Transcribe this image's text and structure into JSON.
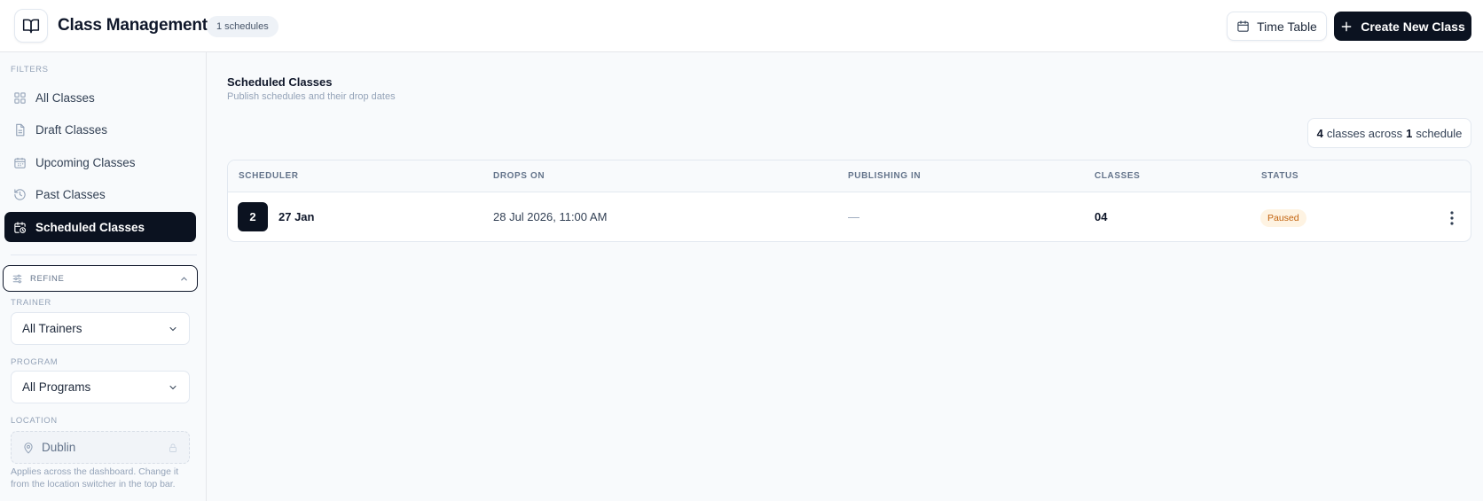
{
  "header": {
    "title": "Class Management",
    "schedule_count": "1 schedules",
    "timetable_label": "Time Table",
    "create_label": "Create New Class"
  },
  "sidebar": {
    "filters_label": "FILTERS",
    "items": [
      {
        "label": "All Classes",
        "icon": "grid-icon"
      },
      {
        "label": "Draft Classes",
        "icon": "document-icon"
      },
      {
        "label": "Upcoming Classes",
        "icon": "calendar-icon"
      },
      {
        "label": "Past Classes",
        "icon": "history-icon"
      },
      {
        "label": "Scheduled Classes",
        "icon": "calendar-clock-icon",
        "active": true
      }
    ],
    "refine_label": "REFINE",
    "trainer": {
      "label": "TRAINER",
      "value": "All Trainers"
    },
    "program": {
      "label": "PROGRAM",
      "value": "All Programs"
    },
    "location": {
      "label": "LOCATION",
      "value": "Dublin",
      "help": "Applies across the dashboard. Change it from the location switcher in the top bar."
    }
  },
  "main": {
    "title": "Scheduled Classes",
    "subtitle": "Publish schedules and their drop dates",
    "summary": {
      "classes": "4",
      "text1": "classes across",
      "schedules": "1",
      "text2": "schedule"
    },
    "table": {
      "columns": [
        "SCHEDULER",
        "DROPS ON",
        "PUBLISHING IN",
        "CLASSES",
        "STATUS"
      ],
      "rows": [
        {
          "badge": "2",
          "scheduler": "27 Jan",
          "drops_on": "28 Jul 2026, 11:00 AM",
          "publishing_in": "—",
          "classes": "04",
          "status": "Paused"
        }
      ]
    }
  },
  "colors": {
    "primary_dark": "#0b1220",
    "status_paused_bg": "#fef3e2",
    "status_paused_text": "#c2610c"
  }
}
